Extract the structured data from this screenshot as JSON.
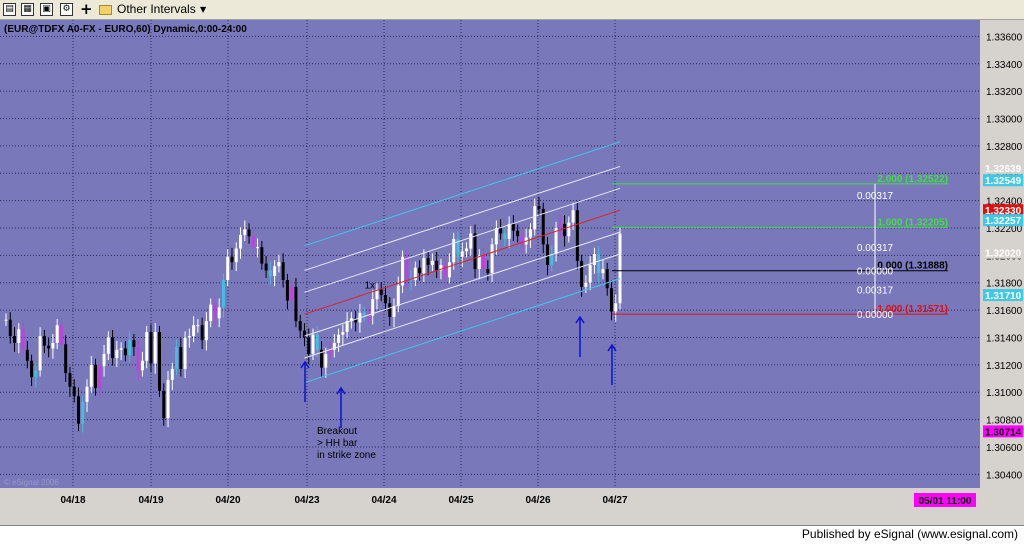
{
  "toolbar": {
    "icons": [
      "chart-icon",
      "table-icon",
      "quote-icon",
      "properties-icon",
      "add-icon",
      "folder-icon"
    ],
    "intervals_label": "Other Intervals"
  },
  "status": {
    "published": "Published by eSignal (www.esignal.com)"
  },
  "colors": {
    "background": "#7878bb",
    "grid": "#5a5a8a",
    "axis_panel": "#d6d3ce",
    "bar_white": "#ffffff",
    "bar_black": "#000000",
    "bar_magenta": "#c040e0",
    "bar_cyan": "#40c0e0",
    "channel_white": "#e8e8f0",
    "channel_cyan": "#40c8e8",
    "regression_red": "#e02020",
    "fib_green": "#40e040",
    "fib_red": "#e01010",
    "fib_black": "#000000",
    "arrow_blue": "#1010d0"
  },
  "chart_data": {
    "type": "candlestick",
    "title": "(EUR@TDFX A0-FX - EURO,60) Dynamic,0:00-24:00",
    "watermark": "© eSignal 2006",
    "ylim": [
      1.303,
      1.3372
    ],
    "y_ticks": [
      "1.33600",
      "1.33400",
      "1.33200",
      "1.33000",
      "1.32800",
      "1.32600",
      "1.32400",
      "1.32200",
      "1.32000",
      "1.31800",
      "1.31600",
      "1.31400",
      "1.31200",
      "1.31000",
      "1.30800",
      "1.30600",
      "1.30400"
    ],
    "x_ticks": [
      "04/18",
      "04/19",
      "04/20",
      "04/23",
      "04/24",
      "04/25",
      "04/26",
      "04/27"
    ],
    "date_axis_badge": "05/01 11:00",
    "price_markers": [
      {
        "label": "1.32549",
        "value": 1.32549,
        "bg": "#40c8e8",
        "fg": "#ffffff"
      },
      {
        "label": "1.32639",
        "value": 1.32639,
        "bg": "#d6d3ce",
        "fg": "#ffffff"
      },
      {
        "label": "1.32330",
        "value": 1.3233,
        "bg": "#e01010",
        "fg": "#ffffff"
      },
      {
        "label": "1.32257",
        "value": 1.32257,
        "bg": "#40c8e8",
        "fg": "#ffffff"
      },
      {
        "label": "1.32020",
        "value": 1.3202,
        "bg": "#d6d3ce",
        "fg": "#ffffff"
      },
      {
        "label": "1.31710",
        "value": 1.3171,
        "bg": "#40c8e8",
        "fg": "#ffffff"
      },
      {
        "label": "1.30714",
        "value": 1.30714,
        "bg": "#ff00ff",
        "fg": "#000000"
      }
    ],
    "fib_levels": [
      {
        "label": "2.000 (1.32522)",
        "value": 1.32522,
        "color": "#40e040"
      },
      {
        "label": "1.000 (1.32205)",
        "value": 1.32205,
        "color": "#40e040"
      },
      {
        "label": "0.000 (1.31888)",
        "value": 1.31888,
        "color": "#000000"
      },
      {
        "label": "-1.000 (1.31571)",
        "value": 1.31571,
        "color": "#e01010"
      }
    ],
    "fib_distances": [
      "0.00317",
      "0.00317",
      "0.00000",
      "0.00317",
      "0.00000"
    ],
    "annotations": [
      "1x",
      "Breakout",
      "> HH bar",
      "in strike zone"
    ],
    "series": [
      {
        "name": "",
        "values": [
          1.3153,
          1.3141,
          1.3136,
          1.3146,
          1.3131,
          1.3123,
          1.3111,
          1.3116,
          1.3141,
          1.3134,
          1.3132,
          1.3136,
          1.3149,
          1.3135,
          1.3114,
          1.3104,
          1.3097,
          1.3077,
          1.3093,
          1.3104,
          1.312,
          1.3103,
          1.3119,
          1.3128,
          1.314,
          1.3125,
          1.3131,
          1.3132,
          1.3127,
          1.3138,
          1.3133,
          1.3116,
          1.3123,
          1.3144,
          1.3121,
          1.3144,
          1.3101,
          1.3081,
          1.3109,
          1.3117,
          1.3133,
          1.3117,
          1.314,
          1.3141,
          1.3149,
          1.3149,
          1.3138,
          1.3152,
          1.3164,
          1.3154,
          1.3162,
          1.3182,
          1.3199,
          1.3195,
          1.3205,
          1.3215,
          1.3219,
          1.3214,
          1.3206,
          1.3206,
          1.3194,
          1.3189,
          1.3185,
          1.3192,
          1.3195,
          1.3182,
          1.3167,
          1.3177,
          1.3152,
          1.3145,
          1.314,
          1.3128,
          1.3142,
          1.3131,
          1.3118,
          1.3128,
          1.3131,
          1.3136,
          1.3142,
          1.3144,
          1.3152,
          1.3154,
          1.3151,
          1.3158,
          1.3156,
          1.3156,
          1.3168,
          1.3175,
          1.3171,
          1.3165,
          1.3155,
          1.3163,
          1.3178,
          1.3199,
          1.3183,
          1.3182,
          1.3191,
          1.3187,
          1.3198,
          1.3193,
          1.3196,
          1.3189,
          1.3193,
          1.3184,
          1.3195,
          1.3212,
          1.3199,
          1.3203,
          1.3205,
          1.3216,
          1.319,
          1.32,
          1.319,
          1.3187,
          1.3208,
          1.322,
          1.3216,
          1.3212,
          1.3223,
          1.3218,
          1.3214,
          1.3208,
          1.3213,
          1.3219,
          1.3236,
          1.3234,
          1.3208,
          1.3193,
          1.3201,
          1.322,
          1.3223,
          1.3214,
          1.3224,
          1.3233,
          1.3196,
          1.3177,
          1.318,
          1.3193,
          1.3201,
          1.3187,
          1.319,
          1.3176,
          1.3159,
          1.3165,
          1.3216
        ]
      }
    ]
  }
}
